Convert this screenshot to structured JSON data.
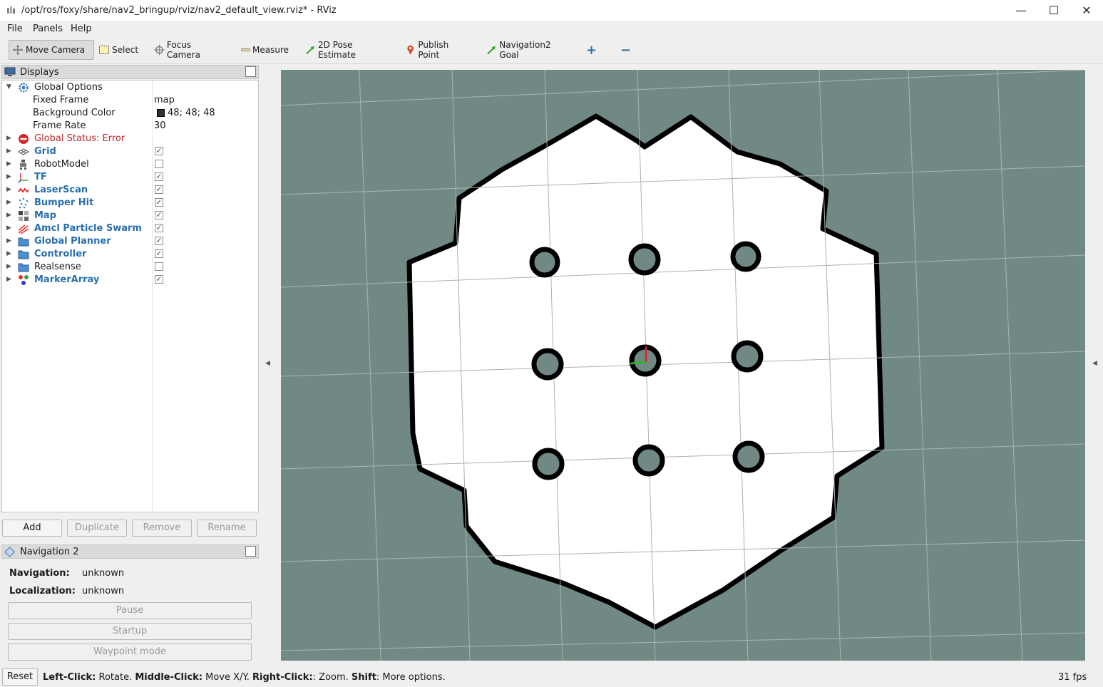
{
  "window": {
    "title": "/opt/ros/foxy/share/nav2_bringup/rviz/nav2_default_view.rviz* - RViz",
    "minimize": "—",
    "maximize": "☐",
    "close": "✕"
  },
  "menu": [
    {
      "label": "File"
    },
    {
      "label": "Panels"
    },
    {
      "label": "Help"
    }
  ],
  "toolbar": {
    "move_camera": "Move Camera",
    "select": "Select",
    "focus_camera": "Focus Camera",
    "measure": "Measure",
    "pose_estimate": "2D Pose Estimate",
    "publish_point": "Publish Point",
    "nav_goal": "Navigation2 Goal",
    "add_tool": "+",
    "remove_tool": "−"
  },
  "displays": {
    "title": "Displays",
    "global_options": {
      "label": "Global Options",
      "fixed_frame_label": "Fixed Frame",
      "fixed_frame_value": "map",
      "background_color_label": "Background Color",
      "background_color_value": "48; 48; 48",
      "background_color_hex": "#303030",
      "frame_rate_label": "Frame Rate",
      "frame_rate_value": "30"
    },
    "global_status": "Global Status: Error",
    "items": [
      {
        "label": "Grid",
        "checked": true
      },
      {
        "label": "RobotModel",
        "checked": false
      },
      {
        "label": "TF",
        "checked": true
      },
      {
        "label": "LaserScan",
        "checked": true
      },
      {
        "label": "Bumper Hit",
        "checked": true
      },
      {
        "label": "Map",
        "checked": true
      },
      {
        "label": "Amcl Particle Swarm",
        "checked": true
      },
      {
        "label": "Global Planner",
        "checked": true
      },
      {
        "label": "Controller",
        "checked": true
      },
      {
        "label": "Realsense",
        "checked": false
      },
      {
        "label": "MarkerArray",
        "checked": true
      }
    ],
    "buttons": {
      "add": "Add",
      "duplicate": "Duplicate",
      "remove": "Remove",
      "rename": "Rename"
    }
  },
  "navigation": {
    "title": "Navigation 2",
    "navigation_label": "Navigation:",
    "navigation_value": "unknown",
    "localization_label": "Localization:",
    "localization_value": "unknown",
    "pause": "Pause",
    "startup": "Startup",
    "waypoint": "Waypoint mode"
  },
  "status": {
    "reset": "Reset",
    "hint_left": "Left-Click:",
    "hint_left_text": " Rotate. ",
    "hint_middle": "Middle-Click:",
    "hint_middle_text": " Move X/Y. ",
    "hint_right": "Right-Click:",
    "hint_right_text": ": Zoom. ",
    "hint_shift": "Shift",
    "hint_shift_text": ": More options.",
    "fps": "31 fps"
  },
  "colors": {
    "viewport_bg": "#718985",
    "free_space": "#ffffff",
    "obstacle": "#000000",
    "accent_blue": "#2a6fb0",
    "error_red": "#c0282a"
  }
}
